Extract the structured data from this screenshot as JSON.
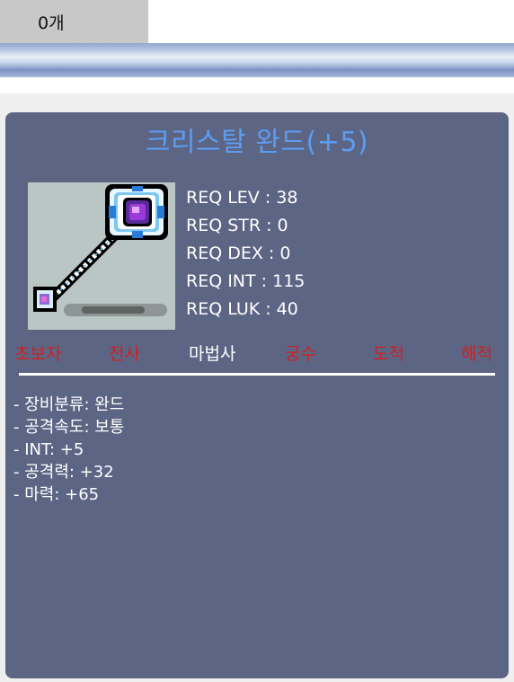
{
  "header": {
    "count_label": "0개"
  },
  "item": {
    "name": "크리스탈 완드(+5)",
    "image_icon": "crystal-wand-icon",
    "requirements": [
      "REQ LEV : 38",
      "REQ STR : 0",
      "REQ DEX : 0",
      "REQ INT : 115",
      "REQ LUK : 40"
    ],
    "jobs": [
      {
        "label": "초보자",
        "available": false
      },
      {
        "label": "전사",
        "available": false
      },
      {
        "label": "마법사",
        "available": true
      },
      {
        "label": "궁수",
        "available": false
      },
      {
        "label": "도적",
        "available": false
      },
      {
        "label": "해적",
        "available": false
      }
    ],
    "stats": [
      "- 장비분류: 완드",
      "- 공격속도: 보통",
      "- INT: +5",
      "- 공격력: +32",
      "- 마력: +65"
    ]
  },
  "colors": {
    "card_bg": "#5d6585",
    "title": "#5c9df2",
    "job_unavailable": "#cc2222",
    "job_available": "#ffffff"
  }
}
